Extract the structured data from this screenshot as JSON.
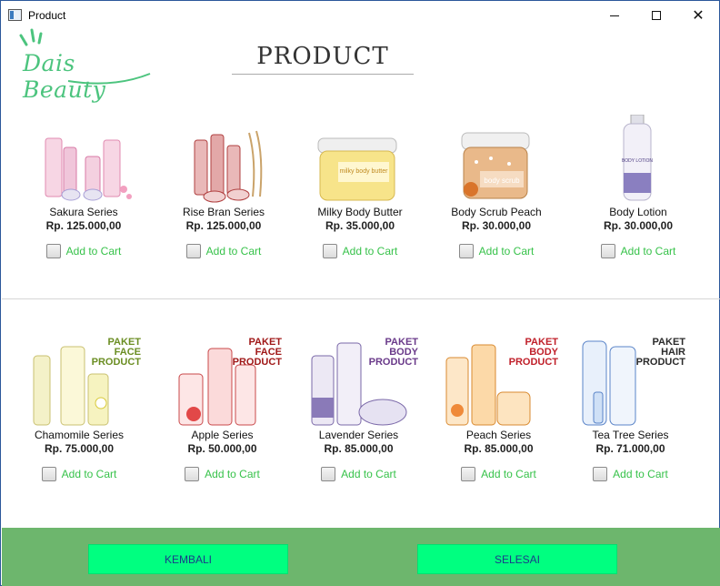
{
  "window": {
    "title": "Product"
  },
  "brand": {
    "logo_text": "Dais Beauty",
    "brand_color": "#4cc47e"
  },
  "page": {
    "title": "PRODUCT"
  },
  "products_row1": [
    {
      "name": "Sakura Series",
      "price": "Rp. 125.000,00",
      "cart_label": "Add to Cart"
    },
    {
      "name": "Rise Bran Series",
      "price": "Rp. 125.000,00",
      "cart_label": "Add to Cart"
    },
    {
      "name": "Milky Body Butter",
      "price": "Rp. 35.000,00",
      "cart_label": "Add to Cart",
      "jar_label": "milky body butter"
    },
    {
      "name": "Body Scrub Peach",
      "price": "Rp. 30.000,00",
      "cart_label": "Add to Cart",
      "jar_label": "body scrub"
    },
    {
      "name": "Body  Lotion",
      "price": "Rp. 30.000,00",
      "cart_label": "Add to Cart",
      "bottle_label": "BODY LOTION"
    }
  ],
  "products_row2": [
    {
      "name": "Chamomile Series",
      "price": "Rp. 75.000,00",
      "cart_label": "Add to Cart",
      "paket": [
        "PAKET",
        "FACE",
        "PRODUCT"
      ],
      "paket_color": "#6b8e23"
    },
    {
      "name": "Apple Series",
      "price": "Rp. 50.000,00",
      "cart_label": "Add to Cart",
      "paket": [
        "PAKET",
        "FACE",
        "PRODUCT"
      ],
      "paket_color": "#a01818"
    },
    {
      "name": "Lavender Series",
      "price": "Rp. 85.000,00",
      "cart_label": "Add to Cart",
      "paket": [
        "PAKET",
        "BODY",
        "PRODUCT"
      ],
      "paket_color": "#6a3a8a"
    },
    {
      "name": "Peach Series",
      "price": "Rp. 85.000,00",
      "cart_label": "Add to Cart",
      "paket": [
        "PAKET",
        "BODY",
        "PRODUCT"
      ],
      "paket_color": "#c0202a"
    },
    {
      "name": "Tea Tree Series",
      "price": "Rp. 71.000,00",
      "cart_label": "Add to Cart",
      "paket": [
        "PAKET",
        "HAIR",
        "PRODUCT"
      ],
      "paket_color": "#2a2a2a"
    }
  ],
  "footer": {
    "back_label": "KEMBALI",
    "finish_label": "SELESAI",
    "footer_color": "#6db66d",
    "button_color": "#00ff80"
  }
}
